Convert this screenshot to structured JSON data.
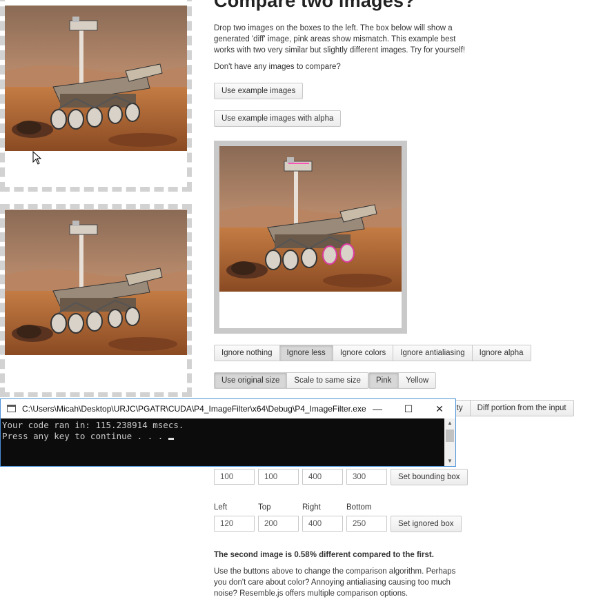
{
  "heading": "Compare two images?",
  "intro": "Drop two images on the boxes to the left. The box below will show a generated 'diff' image, pink areas show mismatch. This example best works with two very similar but slightly different images. Try for yourself!",
  "no_images_prompt": "Don't have any images to compare?",
  "buttons": {
    "use_example": "Use example images",
    "use_example_alpha": "Use example images with alpha"
  },
  "ignore_group": [
    "Ignore nothing",
    "Ignore less",
    "Ignore colors",
    "Ignore antialiasing",
    "Ignore alpha"
  ],
  "ignore_active": "Ignore less",
  "size_group": [
    "Use original size",
    "Scale to same size"
  ],
  "size_active": "Use original size",
  "color_group": [
    "Pink",
    "Yellow"
  ],
  "color_active": "Pink",
  "output_group_partial": "ntensity",
  "output_group_last": "Diff portion from the input",
  "bounding": {
    "values": [
      "100",
      "100",
      "400",
      "300"
    ],
    "button": "Set bounding box"
  },
  "ignored": {
    "labels": [
      "Left",
      "Top",
      "Right",
      "Bottom"
    ],
    "values": [
      "120",
      "200",
      "400",
      "250"
    ],
    "button": "Set ignored box"
  },
  "result": "The second image is 0.58% different compared to the first.",
  "outro": "Use the buttons above to change the comparison algorithm. Perhaps you don't care about color? Annoying antialiasing causing too much noise? Resemble.js offers multiple comparison options.",
  "console": {
    "title": "C:\\Users\\Micah\\Desktop\\URJC\\PGATR\\CUDA\\P4_ImageFilter\\x64\\Debug\\P4_ImageFilter.exe",
    "line1": "Your code ran in: 115.238914 msecs.",
    "line2": "Press any key to continue . . . ",
    "controls": [
      "minimize-icon",
      "maximize-icon",
      "close-icon"
    ]
  },
  "images": {
    "subject": "mars-rover-photo"
  },
  "colors": {
    "console_bg": "#0c0c0c",
    "diff_frame": "#c9c9c9",
    "dropzone_dash": "#d2d2d2"
  }
}
